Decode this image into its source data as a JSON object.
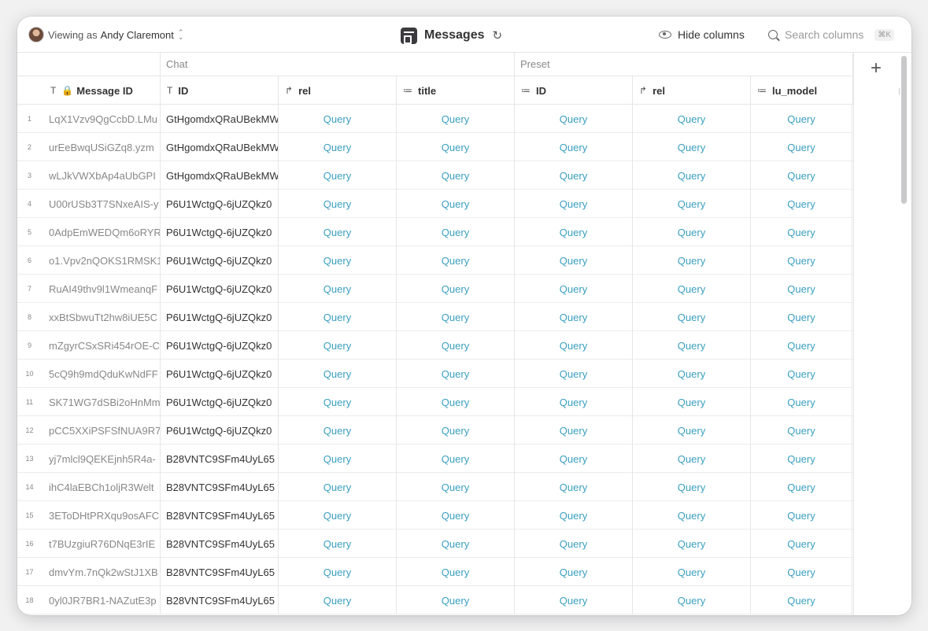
{
  "toolbar": {
    "viewing_prefix": "Viewing as",
    "viewing_user": "Andy Claremont",
    "title": "Messages",
    "hide_columns": "Hide columns",
    "search_placeholder": "Search columns",
    "search_shortcut": "⌘K"
  },
  "groups": {
    "chat": "Chat",
    "preset": "Preset"
  },
  "columns": [
    {
      "label": "Message ID",
      "icon": "text-icon"
    },
    {
      "label": "ID",
      "icon": "text-icon"
    },
    {
      "label": "rel",
      "icon": "relation-icon"
    },
    {
      "label": "title",
      "icon": "lookup-icon"
    },
    {
      "label": "ID",
      "icon": "lookup-icon"
    },
    {
      "label": "rel",
      "icon": "relation-icon"
    },
    {
      "label": "lu_model",
      "icon": "lookup-icon"
    }
  ],
  "query_label": "Query",
  "rows": [
    {
      "n": "1",
      "message_id": "LqX1Vzv9QgCcbD.LMu",
      "chat_id": "GtHgomdxQRaUBekMW"
    },
    {
      "n": "2",
      "message_id": "urEeBwqUSiGZq8.yzm",
      "chat_id": "GtHgomdxQRaUBekMW"
    },
    {
      "n": "3",
      "message_id": "wLJkVWXbAp4aUbGPI",
      "chat_id": "GtHgomdxQRaUBekMW"
    },
    {
      "n": "4",
      "message_id": "U00rUSb3T7SNxeAIS-y",
      "chat_id": "P6U1WctgQ-6jUZQkz0"
    },
    {
      "n": "5",
      "message_id": "0AdpEmWEDQm6oRYR",
      "chat_id": "P6U1WctgQ-6jUZQkz0"
    },
    {
      "n": "6",
      "message_id": "o1.Vpv2nQOKS1RMSK1",
      "chat_id": "P6U1WctgQ-6jUZQkz0"
    },
    {
      "n": "7",
      "message_id": "RuAI49thv9l1WmeanqF",
      "chat_id": "P6U1WctgQ-6jUZQkz0"
    },
    {
      "n": "8",
      "message_id": "xxBtSbwuTt2hw8iUE5C",
      "chat_id": "P6U1WctgQ-6jUZQkz0"
    },
    {
      "n": "9",
      "message_id": "mZgyrCSxSRi454rOE-C",
      "chat_id": "P6U1WctgQ-6jUZQkz0"
    },
    {
      "n": "10",
      "message_id": "5cQ9h9mdQduKwNdFF",
      "chat_id": "P6U1WctgQ-6jUZQkz0"
    },
    {
      "n": "11",
      "message_id": "SK71WG7dSBi2oHnMm",
      "chat_id": "P6U1WctgQ-6jUZQkz0"
    },
    {
      "n": "12",
      "message_id": "pCC5XXiPSFSfNUA9R7",
      "chat_id": "P6U1WctgQ-6jUZQkz0"
    },
    {
      "n": "13",
      "message_id": "yj7mlcl9QEKEjnh5R4a-",
      "chat_id": "B28VNTC9SFm4UyL65"
    },
    {
      "n": "14",
      "message_id": "ihC4laEBCh1oljR3Welt",
      "chat_id": "B28VNTC9SFm4UyL65"
    },
    {
      "n": "15",
      "message_id": "3EToDHtPRXqu9osAFC",
      "chat_id": "B28VNTC9SFm4UyL65"
    },
    {
      "n": "16",
      "message_id": "t7BUzgiuR76DNqE3rIE",
      "chat_id": "B28VNTC9SFm4UyL65"
    },
    {
      "n": "17",
      "message_id": "dmvYm.7nQk2wStJ1XB",
      "chat_id": "B28VNTC9SFm4UyL65"
    },
    {
      "n": "18",
      "message_id": "0yl0JR7BR1-NAZutE3p",
      "chat_id": "B28VNTC9SFm4UyL65"
    }
  ]
}
